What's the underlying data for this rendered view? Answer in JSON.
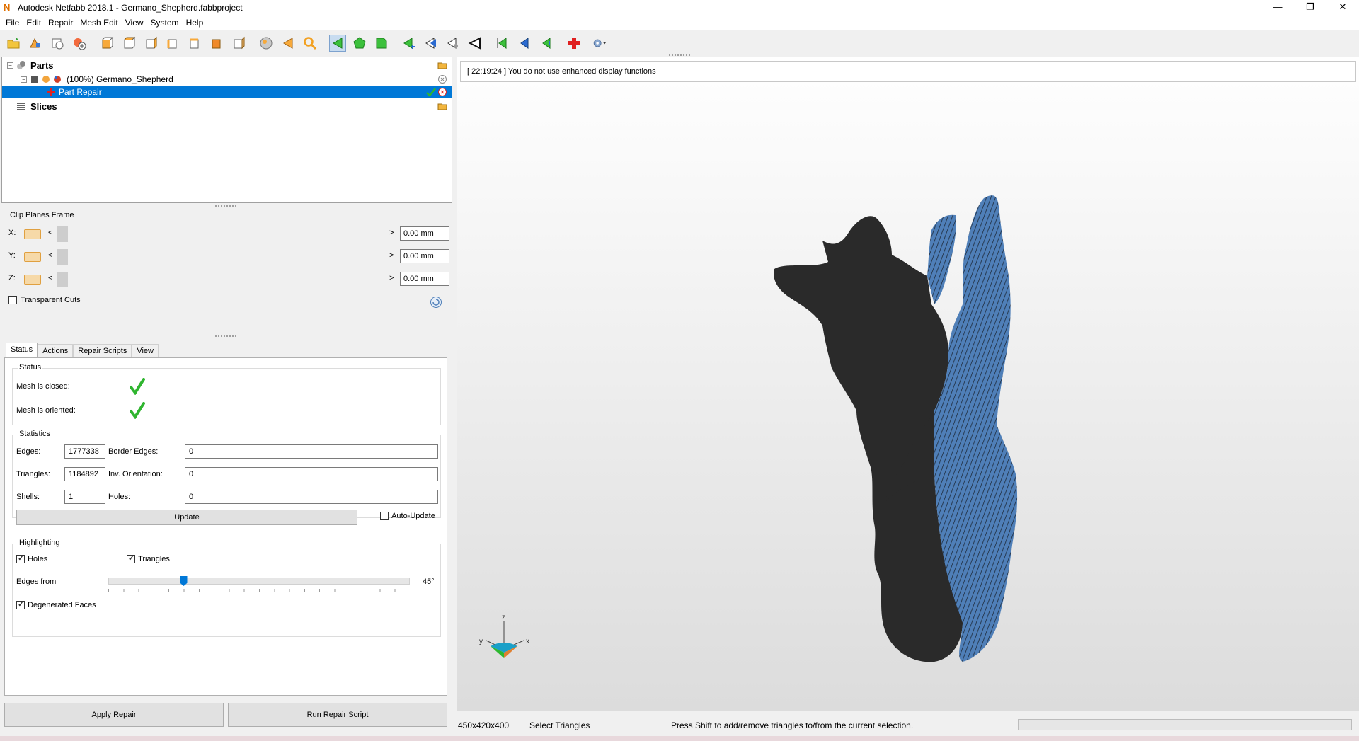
{
  "window": {
    "title": "Autodesk Netfabb 2018.1 - Germano_Shepherd.fabbproject",
    "minimize": "—",
    "restore": "❐",
    "close": "✕"
  },
  "menu": [
    "File",
    "Edit",
    "Repair",
    "Mesh Edit",
    "View",
    "System",
    "Help"
  ],
  "tree": {
    "parts": "Parts",
    "part": "(100%) Germano_Shepherd",
    "repair": "Part Repair",
    "slices": "Slices"
  },
  "clip": {
    "title": "Clip Planes Frame",
    "rows": [
      {
        "axis": "X:",
        "value": "0.00 mm"
      },
      {
        "axis": "Y:",
        "value": "0.00 mm"
      },
      {
        "axis": "Z:",
        "value": "0.00 mm"
      }
    ],
    "transparent": "Transparent Cuts",
    "lt": "<",
    "gt": ">"
  },
  "tabs": [
    "Status",
    "Actions",
    "Repair Scripts",
    "View"
  ],
  "status": {
    "title": "Status",
    "closed": "Mesh is closed:",
    "oriented": "Mesh is oriented:"
  },
  "statistics": {
    "title": "Statistics",
    "edges_label": "Edges:",
    "edges": "1777338",
    "border_label": "Border Edges:",
    "border": "0",
    "triangles_label": "Triangles:",
    "triangles": "1184892",
    "inv_label": "Inv. Orientation:",
    "inv": "0",
    "shells_label": "Shells:",
    "shells": "1",
    "holes_label": "Holes:",
    "holes": "0",
    "update": "Update",
    "auto_update": "Auto-Update"
  },
  "highlighting": {
    "title": "Highlighting",
    "holes": "Holes",
    "triangles": "Triangles",
    "edges_from": "Edges from",
    "angle": "45°",
    "angle_fraction": 0.25,
    "degenerated": "Degenerated Faces"
  },
  "buttons": {
    "apply": "Apply Repair",
    "run": "Run Repair Script"
  },
  "log": "[ 22:19:24 ] You do not use enhanced display functions",
  "axes": {
    "z": "z",
    "y": "y",
    "x": "x"
  },
  "statusbar": {
    "size": "450x420x400",
    "mode": "Select Triangles",
    "hint": "Press Shift to add/remove triangles to/from the current selection."
  },
  "colors": {
    "selection": "#0078d7",
    "model_dark": "#2a2a2a",
    "model_blue": "#4f7fb8",
    "check_green": "#2fb52f"
  }
}
